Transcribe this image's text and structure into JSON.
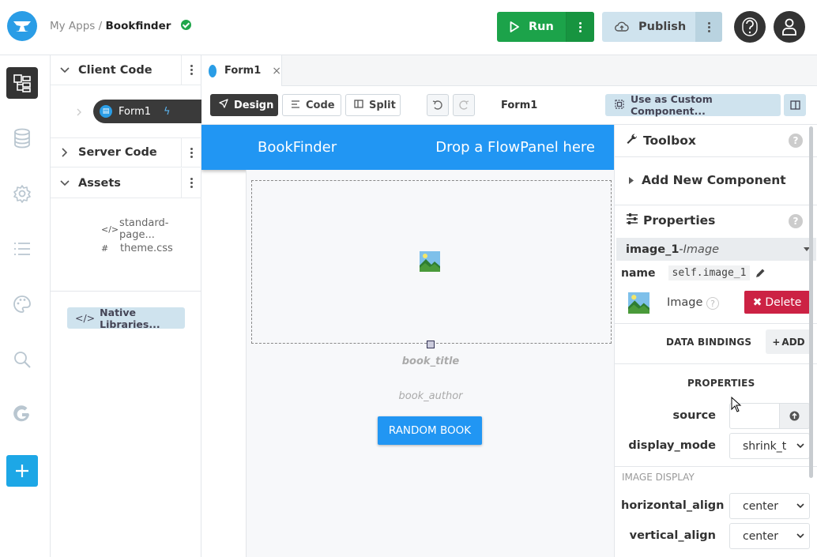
{
  "breadcrumb": {
    "root": "My Apps",
    "separator": "/",
    "app": "Bookfinder"
  },
  "topbar": {
    "run_label": "Run",
    "publish_label": "Publish"
  },
  "tree": {
    "client_code": "Client Code",
    "form1": "Form1",
    "server_code": "Server Code",
    "assets": "Assets",
    "asset_items": [
      {
        "icon": "</>",
        "name": "standard-page..."
      },
      {
        "icon": "#",
        "name": "theme.css"
      }
    ],
    "native_libraries": "Native Libraries..."
  },
  "tab": {
    "label": "Form1",
    "close": "×"
  },
  "toolbar": {
    "design": "Design",
    "code": "Code",
    "split": "Split",
    "form_name": "Form1",
    "custom_component": "Use as Custom Component..."
  },
  "canvas": {
    "app_title": "BookFinder",
    "drop_hint": "Drop a FlowPanel here",
    "book_title": "book_title",
    "book_author": "book_author",
    "random_button": "RANDOM BOOK"
  },
  "panel": {
    "toolbox": "Toolbox",
    "add_new_component": "Add New Component",
    "properties": "Properties",
    "component_name": "image_1",
    "component_sep": " - ",
    "component_type": "Image",
    "name_label": "name",
    "name_value": "self.image_1",
    "component_label": "Image",
    "delete": "Delete",
    "data_bindings": "DATA BINDINGS",
    "add": "ADD",
    "properties_section": "PROPERTIES",
    "source_label": "source",
    "source_value": "",
    "display_mode_label": "display_mode",
    "display_mode_value": "shrink_t",
    "image_display": "IMAGE DISPLAY",
    "horizontal_align_label": "horizontal_align",
    "horizontal_align_value": "center",
    "vertical_align_label": "vertical_align",
    "vertical_align_value": "center"
  },
  "colors": {
    "accent": "#2196f3",
    "run": "#1ca34a",
    "publish": "#cfe3ee",
    "delete": "#cc2244",
    "brand": "#2a9de6"
  }
}
